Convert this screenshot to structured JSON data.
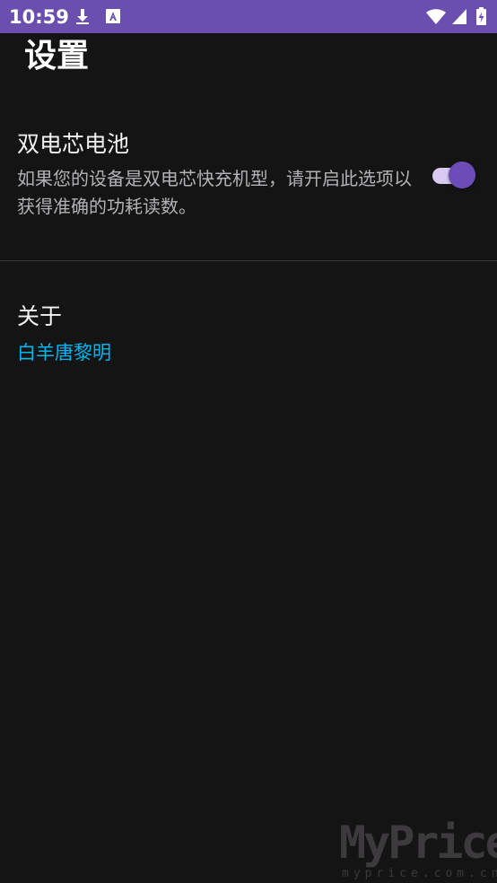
{
  "status_bar": {
    "time": "10:59",
    "background_color": "#6b4fae",
    "left_icons": [
      "download-icon",
      "a-notification-icon"
    ],
    "right_icons": [
      "wifi-icon",
      "signal-icon",
      "battery-charging-icon"
    ]
  },
  "page": {
    "title": "设置"
  },
  "settings": {
    "dual_cell_battery": {
      "title": "双电芯电池",
      "description": "如果您的设备是双电芯快充机型，请开启此选项以获得准确的功耗读数。",
      "toggle_on": true,
      "accent_color": "#6c4db8"
    },
    "about": {
      "title": "关于",
      "value": "白羊唐黎明",
      "value_color": "#00b4ee"
    }
  },
  "watermark": {
    "main": "MyPrice",
    "sub": "myprice.com.cn"
  }
}
